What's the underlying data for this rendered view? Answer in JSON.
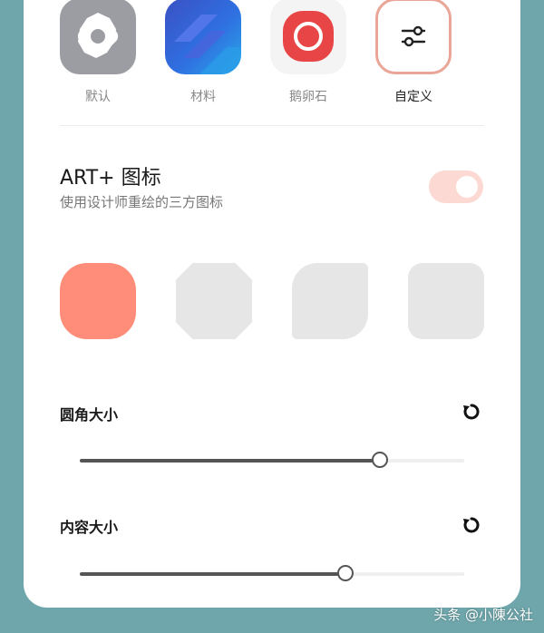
{
  "icon_styles": [
    {
      "label": "默认",
      "icon": "gear-icon",
      "selected": false
    },
    {
      "label": "材料",
      "icon": "material-layers-icon",
      "selected": false
    },
    {
      "label": "鹅卵石",
      "icon": "circle-icon",
      "selected": false
    },
    {
      "label": "自定义",
      "icon": "sliders-icon",
      "selected": true
    }
  ],
  "art_plus": {
    "title": "ART+ 图标",
    "subtitle": "使用设计师重绘的三方图标",
    "enabled": true
  },
  "shapes": [
    {
      "name": "squircle",
      "selected": true
    },
    {
      "name": "octagon",
      "selected": false
    },
    {
      "name": "leaf",
      "selected": false
    },
    {
      "name": "rounded-square",
      "selected": false
    }
  ],
  "corner_size": {
    "label": "圆角大小",
    "value": 0.78
  },
  "content_size": {
    "label": "内容大小",
    "value": 0.69
  },
  "watermark": "头条 @小陳公社",
  "colors": {
    "accent": "#ff8d7a",
    "toggle": "#fcd9d2",
    "background": "#6ea6ab"
  }
}
